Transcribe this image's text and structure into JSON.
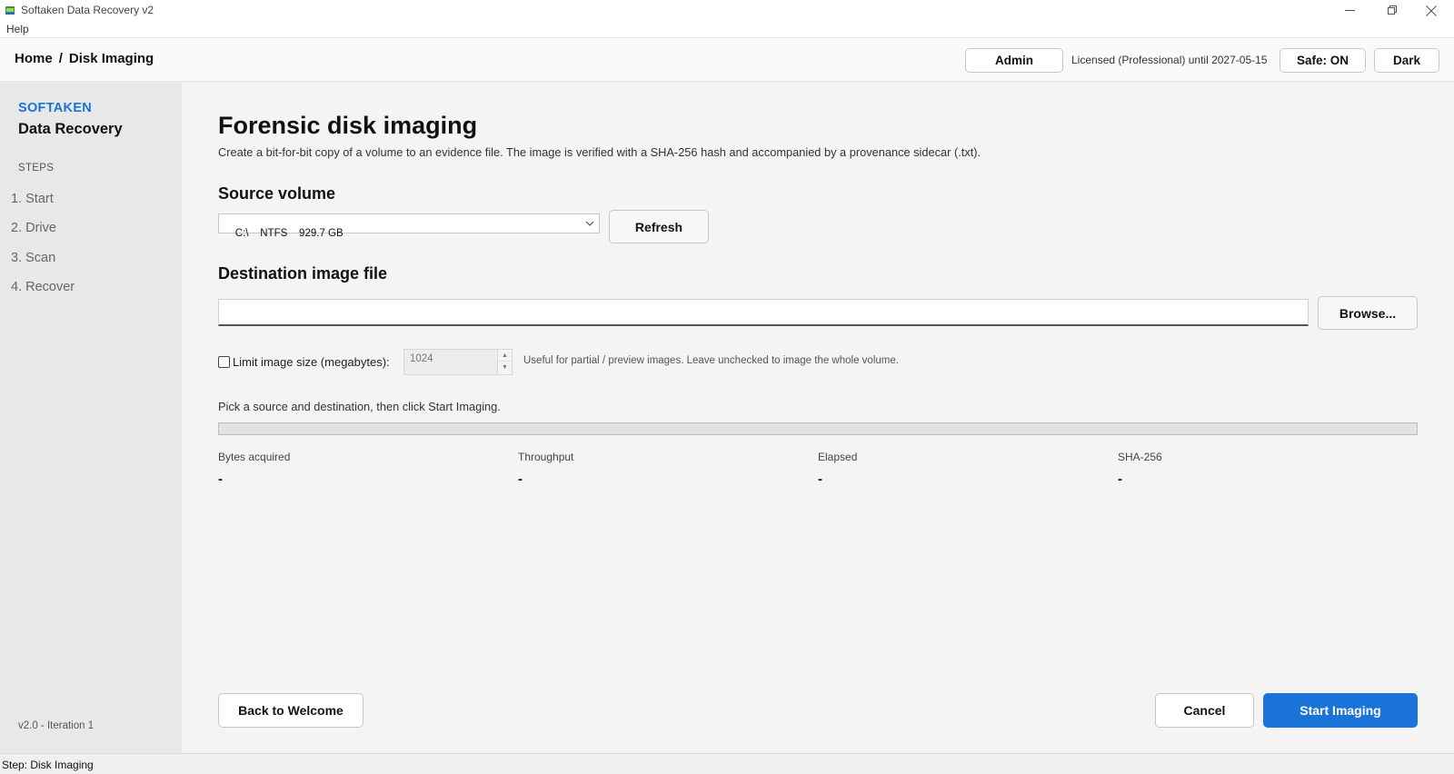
{
  "window": {
    "title": "Softaken Data Recovery v2",
    "controls": [
      "minimize-icon",
      "restore-icon",
      "close-icon"
    ]
  },
  "menu": {
    "help": "Help"
  },
  "header": {
    "breadcrumb_home": "Home",
    "breadcrumb_sep": "/",
    "breadcrumb_current": "Disk Imaging",
    "admin_label": "Admin",
    "license_text": "Licensed (Professional) until 2027-05-15",
    "safe_label": "Safe: ON",
    "theme_label": "Dark"
  },
  "sidebar": {
    "brand_top": "SOFTAKEN",
    "brand_bottom": "Data Recovery",
    "steps_label": "STEPS",
    "steps": [
      {
        "label": "1. Start"
      },
      {
        "label": "2. Drive"
      },
      {
        "label": "3. Scan"
      },
      {
        "label": "4. Recover"
      }
    ],
    "version": "v2.0  -  Iteration 1"
  },
  "main": {
    "title": "Forensic disk imaging",
    "description": "Create a bit-for-bit copy of a volume to an evidence file. The image is verified with a SHA-256 hash and accompanied by a provenance sidecar (.txt).",
    "source_heading": "Source volume",
    "source_selected": "C:\\    NTFS    929.7 GB",
    "refresh_label": "Refresh",
    "dest_heading": "Destination image file",
    "dest_value": "",
    "browse_label": "Browse...",
    "limit_label": "Limit image size (megabytes):",
    "limit_checked": false,
    "limit_value": "1024",
    "limit_hint": "Useful for partial / preview images. Leave unchecked to image the whole volume.",
    "status_text": "Pick a source and destination, then click Start Imaging.",
    "progress_fraction": 0,
    "stats": [
      {
        "label": "Bytes acquired",
        "value": "-"
      },
      {
        "label": "Throughput",
        "value": "-"
      },
      {
        "label": "Elapsed",
        "value": "-"
      },
      {
        "label": "SHA-256",
        "value": "-"
      }
    ],
    "back_label": "Back to Welcome",
    "cancel_label": "Cancel",
    "start_label": "Start Imaging"
  },
  "statusbar": {
    "text": "Step: Disk Imaging"
  },
  "colors": {
    "accent": "#1a73d9",
    "sidebar_bg": "#e8e8e8",
    "main_bg": "#f4f4f4"
  }
}
